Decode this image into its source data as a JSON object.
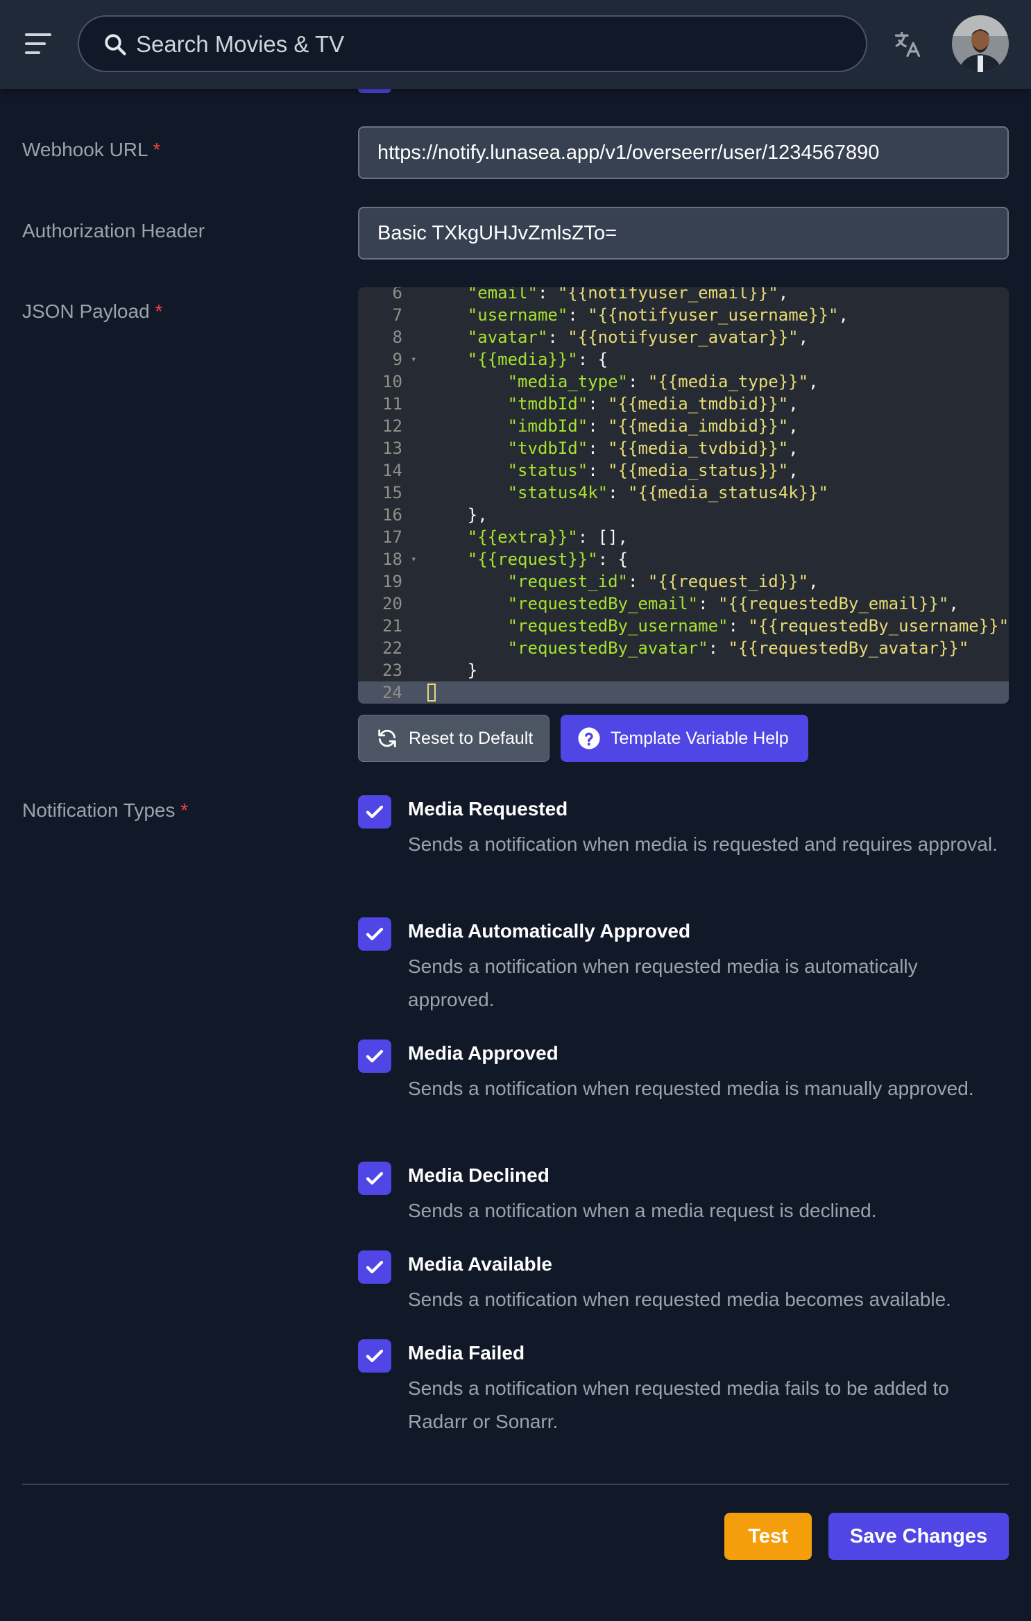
{
  "header": {
    "search_placeholder": "Search Movies & TV"
  },
  "form": {
    "webhook_url": {
      "label": "Webhook URL",
      "required_mark": "*",
      "value": "https://notify.lunasea.app/v1/overseerr/user/1234567890"
    },
    "auth_header": {
      "label": "Authorization Header",
      "value": "Basic TXkgUHJvZmlsZTo="
    },
    "json_payload": {
      "label": "JSON Payload",
      "required_mark": "*",
      "lines": [
        {
          "n": "6",
          "fold": "",
          "text": "    \"email\": \"{{notifyuser_email}}\","
        },
        {
          "n": "7",
          "fold": "",
          "text": "    \"username\": \"{{notifyuser_username}}\","
        },
        {
          "n": "8",
          "fold": "",
          "text": "    \"avatar\": \"{{notifyuser_avatar}}\","
        },
        {
          "n": "9",
          "fold": "▾",
          "text": "    \"{{media}}\": {"
        },
        {
          "n": "10",
          "fold": "",
          "text": "        \"media_type\": \"{{media_type}}\","
        },
        {
          "n": "11",
          "fold": "",
          "text": "        \"tmdbId\": \"{{media_tmdbid}}\","
        },
        {
          "n": "12",
          "fold": "",
          "text": "        \"imdbId\": \"{{media_imdbid}}\","
        },
        {
          "n": "13",
          "fold": "",
          "text": "        \"tvdbId\": \"{{media_tvdbid}}\","
        },
        {
          "n": "14",
          "fold": "",
          "text": "        \"status\": \"{{media_status}}\","
        },
        {
          "n": "15",
          "fold": "",
          "text": "        \"status4k\": \"{{media_status4k}}\""
        },
        {
          "n": "16",
          "fold": "",
          "text": "    },"
        },
        {
          "n": "17",
          "fold": "",
          "text": "    \"{{extra}}\": [],"
        },
        {
          "n": "18",
          "fold": "▾",
          "text": "    \"{{request}}\": {"
        },
        {
          "n": "19",
          "fold": "",
          "text": "        \"request_id\": \"{{request_id}}\","
        },
        {
          "n": "20",
          "fold": "",
          "text": "        \"requestedBy_email\": \"{{requestedBy_email}}\","
        },
        {
          "n": "21",
          "fold": "",
          "text": "        \"requestedBy_username\": \"{{requestedBy_username}}\""
        },
        {
          "n": "22",
          "fold": "",
          "text": "        \"requestedBy_avatar\": \"{{requestedBy_avatar}}\""
        },
        {
          "n": "23",
          "fold": "",
          "text": "    }"
        },
        {
          "n": "24",
          "fold": "",
          "text": "}"
        }
      ],
      "reset_label": "Reset to Default",
      "help_label": "Template Variable Help"
    },
    "notification_types": {
      "label": "Notification Types",
      "required_mark": "*",
      "items": [
        {
          "title": "Media Requested",
          "desc": "Sends a notification when media is requested and requires approval.",
          "checked": true
        },
        {
          "title": "Media Automatically Approved",
          "desc": "Sends a notification when requested media is automatically approved.",
          "checked": true
        },
        {
          "title": "Media Approved",
          "desc": "Sends a notification when requested media is manually approved.",
          "checked": true
        },
        {
          "title": "Media Declined",
          "desc": "Sends a notification when a media request is declined.",
          "checked": true
        },
        {
          "title": "Media Available",
          "desc": "Sends a notification when requested media becomes available.",
          "checked": true
        },
        {
          "title": "Media Failed",
          "desc": "Sends a notification when requested media fails to be added to Radarr or Sonarr.",
          "checked": true
        }
      ]
    }
  },
  "actions": {
    "test_label": "Test",
    "save_label": "Save Changes"
  },
  "colors": {
    "accent": "#4f46e5",
    "test_button": "#f59e0b",
    "required": "#ef4444",
    "json_key": "#a6e22e",
    "json_string": "#e6db74"
  }
}
